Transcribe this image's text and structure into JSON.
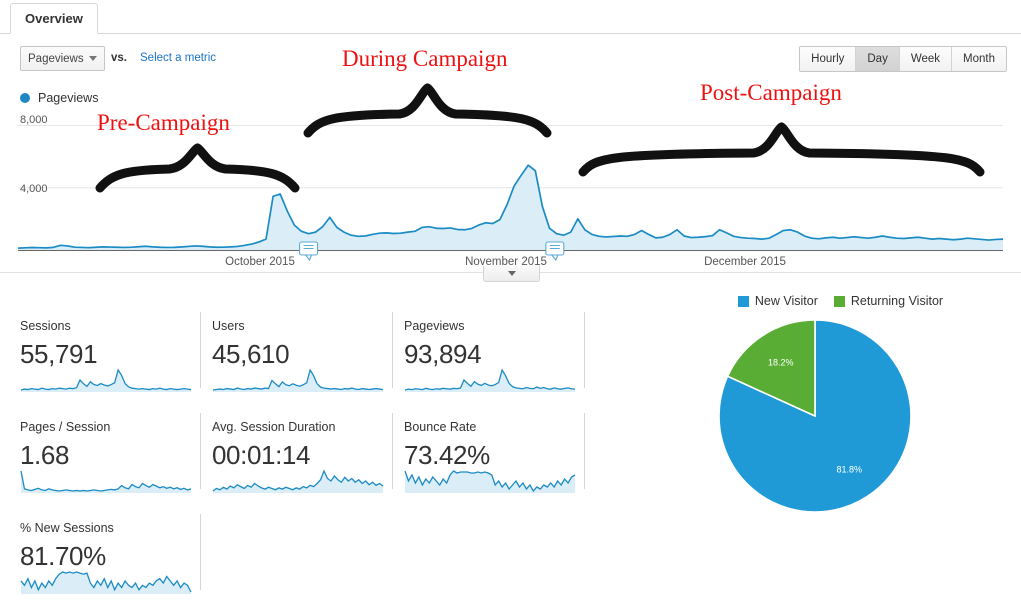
{
  "tab": {
    "label": "Overview"
  },
  "controls": {
    "metric_select_value": "Pageviews",
    "vs_label": "vs.",
    "select_metric_link": "Select a metric",
    "periods": [
      {
        "label": "Hourly",
        "selected": false
      },
      {
        "label": "Day",
        "selected": true
      },
      {
        "label": "Week",
        "selected": false
      },
      {
        "label": "Month",
        "selected": false
      }
    ]
  },
  "chart_legend": {
    "series_label": "Pageviews"
  },
  "annotations": [
    {
      "text": "Pre-Campaign"
    },
    {
      "text": "During Campaign"
    },
    {
      "text": "Post-Campaign"
    }
  ],
  "metrics": [
    [
      {
        "label": "Sessions",
        "value": "55,791"
      },
      {
        "label": "Users",
        "value": "45,610"
      },
      {
        "label": "Pageviews",
        "value": "93,894"
      }
    ],
    [
      {
        "label": "Pages / Session",
        "value": "1.68"
      },
      {
        "label": "Avg. Session Duration",
        "value": "00:01:14"
      },
      {
        "label": "Bounce Rate",
        "value": "73.42%"
      }
    ],
    [
      {
        "label": "% New Sessions",
        "value": "81.70%"
      }
    ]
  ],
  "colors": {
    "line": "#1b8bc4",
    "line_fill": "#dbeef8",
    "legend_dot": "#1e88c5",
    "pie_new": "#1f9ad6",
    "pie_returning": "#5aad34",
    "annotation": "#ee1111"
  },
  "chart_data": {
    "type": "area",
    "title": "Pageviews",
    "xlabel": "",
    "ylabel": "Pageviews",
    "ylim": [
      0,
      9000
    ],
    "ytick_labels": [
      "8,000",
      "4,000"
    ],
    "ytick_values": [
      8000,
      4000
    ],
    "xtick_labels": [
      "October 2015",
      "November 2015",
      "December 2015"
    ],
    "grid": true,
    "legend_position": "top-left",
    "series": [
      {
        "name": "Pageviews",
        "values": [
          120,
          140,
          160,
          150,
          135,
          170,
          300,
          260,
          180,
          165,
          150,
          175,
          200,
          190,
          175,
          165,
          180,
          210,
          240,
          200,
          175,
          165,
          170,
          195,
          230,
          260,
          240,
          200,
          175,
          180,
          200,
          230,
          300,
          380,
          520,
          700,
          3450,
          3600,
          2500,
          1600,
          1200,
          1050,
          1150,
          1500,
          2100,
          1450,
          1150,
          950,
          880,
          900,
          1000,
          1080,
          1100,
          1060,
          1080,
          1150,
          1200,
          1450,
          1500,
          1400,
          1380,
          1420,
          1320,
          1300,
          1380,
          1600,
          1750,
          1700,
          1950,
          2900,
          4100,
          4800,
          5450,
          5100,
          2800,
          1400,
          1050,
          950,
          1150,
          2000,
          1300,
          1000,
          880,
          840,
          870,
          900,
          880,
          1000,
          1250,
          1000,
          780,
          820,
          1000,
          1300,
          900,
          800,
          820,
          860,
          920,
          1300,
          1100,
          880,
          800,
          760,
          740,
          700,
          760,
          1000,
          1250,
          1300,
          1150,
          900,
          760,
          720,
          780,
          820,
          760,
          800,
          850,
          800,
          760,
          820,
          900,
          820,
          760,
          740,
          780,
          820,
          760,
          700,
          740,
          700,
          660,
          700,
          760,
          720,
          680,
          640,
          680,
          700
        ]
      }
    ],
    "annotation_markers": [
      {
        "position_pct": 29.5,
        "label": "annotation"
      },
      {
        "position_pct": 54.5,
        "label": "annotation"
      }
    ]
  },
  "sparklines": {
    "sessions": [
      8,
      10,
      9,
      11,
      10,
      9,
      12,
      10,
      9,
      11,
      10,
      12,
      11,
      10,
      12,
      11,
      13,
      30,
      22,
      16,
      26,
      20,
      18,
      22,
      19,
      17,
      20,
      24,
      52,
      40,
      22,
      15,
      12,
      11,
      10,
      11,
      10,
      9,
      11,
      10,
      12,
      10,
      9,
      11,
      10,
      9,
      10,
      11,
      10,
      9
    ],
    "users": [
      8,
      9,
      10,
      9,
      11,
      10,
      9,
      12,
      10,
      9,
      11,
      10,
      12,
      11,
      10,
      12,
      11,
      28,
      21,
      15,
      25,
      19,
      17,
      21,
      18,
      16,
      19,
      23,
      50,
      38,
      21,
      14,
      12,
      11,
      10,
      11,
      10,
      9,
      11,
      10,
      12,
      10,
      9,
      11,
      10,
      9,
      10,
      11,
      10,
      9
    ],
    "pageviews": [
      8,
      10,
      9,
      11,
      10,
      9,
      12,
      10,
      9,
      11,
      10,
      12,
      11,
      10,
      12,
      11,
      13,
      32,
      24,
      17,
      28,
      22,
      19,
      24,
      20,
      18,
      21,
      26,
      56,
      42,
      24,
      16,
      13,
      12,
      11,
      14,
      12,
      11,
      15,
      12,
      14,
      11,
      10,
      13,
      11,
      10,
      12,
      13,
      11,
      10
    ],
    "pages_per_session": [
      45,
      12,
      10,
      9,
      11,
      13,
      10,
      9,
      12,
      10,
      9,
      8,
      9,
      10,
      9,
      8,
      9,
      8,
      9,
      8,
      9,
      10,
      9,
      8,
      9,
      10,
      11,
      10,
      12,
      18,
      14,
      12,
      20,
      16,
      14,
      22,
      18,
      15,
      20,
      17,
      14,
      16,
      13,
      15,
      12,
      14,
      11,
      13,
      10,
      12
    ],
    "avg_duration": [
      10,
      14,
      12,
      16,
      13,
      18,
      15,
      20,
      17,
      14,
      19,
      16,
      22,
      18,
      15,
      13,
      16,
      14,
      12,
      15,
      13,
      16,
      14,
      12,
      15,
      13,
      17,
      15,
      19,
      17,
      22,
      28,
      42,
      30,
      26,
      34,
      28,
      24,
      32,
      26,
      30,
      24,
      28,
      22,
      26,
      20,
      24,
      19,
      22,
      18
    ],
    "bounce_rate": [
      62,
      52,
      58,
      50,
      56,
      48,
      54,
      50,
      56,
      52,
      48,
      54,
      50,
      58,
      62,
      60,
      61,
      61,
      61,
      60,
      60,
      61,
      60,
      61,
      60,
      58,
      48,
      52,
      46,
      50,
      44,
      48,
      52,
      46,
      50,
      44,
      48,
      42,
      46,
      44,
      48,
      46,
      50,
      46,
      52,
      48,
      54,
      50,
      56,
      58
    ],
    "pct_new_sessions": [
      50,
      46,
      52,
      44,
      50,
      42,
      48,
      44,
      50,
      46,
      52,
      56,
      58,
      57,
      58,
      57,
      58,
      57,
      56,
      57,
      48,
      44,
      50,
      46,
      52,
      44,
      50,
      42,
      48,
      44,
      50,
      46,
      44,
      48,
      42,
      46,
      44,
      48,
      46,
      50,
      52,
      48,
      54,
      50,
      46,
      50,
      44,
      48,
      46,
      40
    ]
  },
  "pie": {
    "legend": [
      {
        "label": "New Visitor",
        "color": "#1f9ad6"
      },
      {
        "label": "Returning Visitor",
        "color": "#5aad34"
      }
    ],
    "slices": [
      {
        "label": "New Visitor",
        "percent_label": "81.8%",
        "value": 81.8,
        "color": "#1f9ad6"
      },
      {
        "label": "Returning Visitor",
        "percent_label": "18.2%",
        "value": 18.2,
        "color": "#5aad34"
      }
    ]
  }
}
